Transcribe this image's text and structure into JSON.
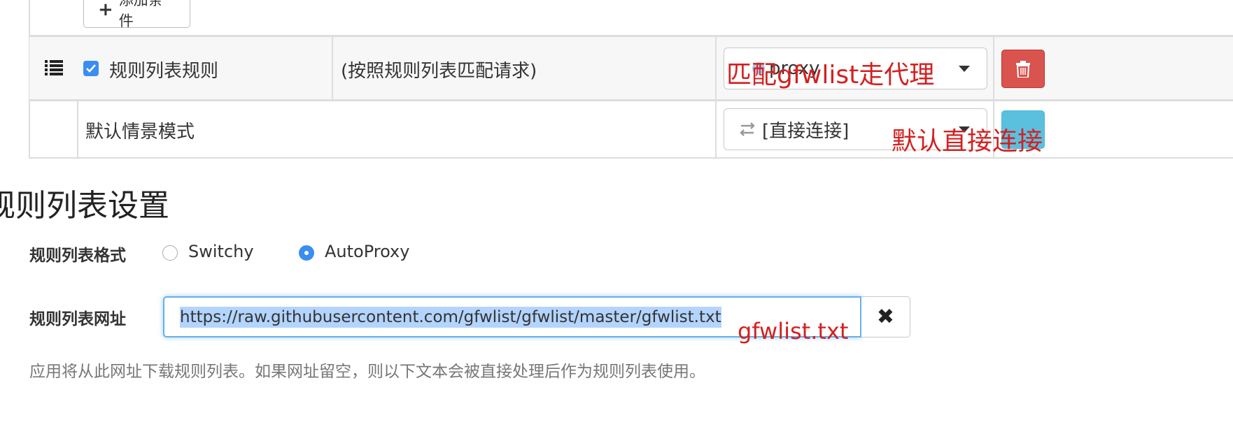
{
  "add_condition": {
    "label": "添加条件",
    "icon": "plus-icon"
  },
  "rules": [
    {
      "checked": true,
      "name": "规则列表规则",
      "description": "(按照规则列表匹配请求)",
      "profile": "proxy",
      "action_icon": "trash-icon"
    }
  ],
  "default_rule": {
    "name": "默认情景模式",
    "profile": "[直接连接]",
    "profile_icon": "exchange-icon"
  },
  "section": {
    "title": "规则列表设置",
    "format_label": "规则列表格式",
    "format_options": [
      {
        "label": "Switchy",
        "selected": false
      },
      {
        "label": "AutoProxy",
        "selected": true
      }
    ],
    "url_label": "规则列表网址",
    "url_value": "https://raw.githubusercontent.com/gfwlist/gfwlist/master/gfwlist.txt",
    "help_text": "应用将从此网址下载规则列表。如果网址留空，则以下文本会被直接处理后作为规则列表使用。"
  },
  "annotations": {
    "proxy_note": "匹配gfwlist走代理",
    "direct_note": "默认直接连接",
    "url_note": "gfwlist.txt"
  },
  "colors": {
    "danger": "#d9534f",
    "info": "#5bc0de",
    "accent": "#3b8ef0",
    "annotation": "#d42020"
  }
}
